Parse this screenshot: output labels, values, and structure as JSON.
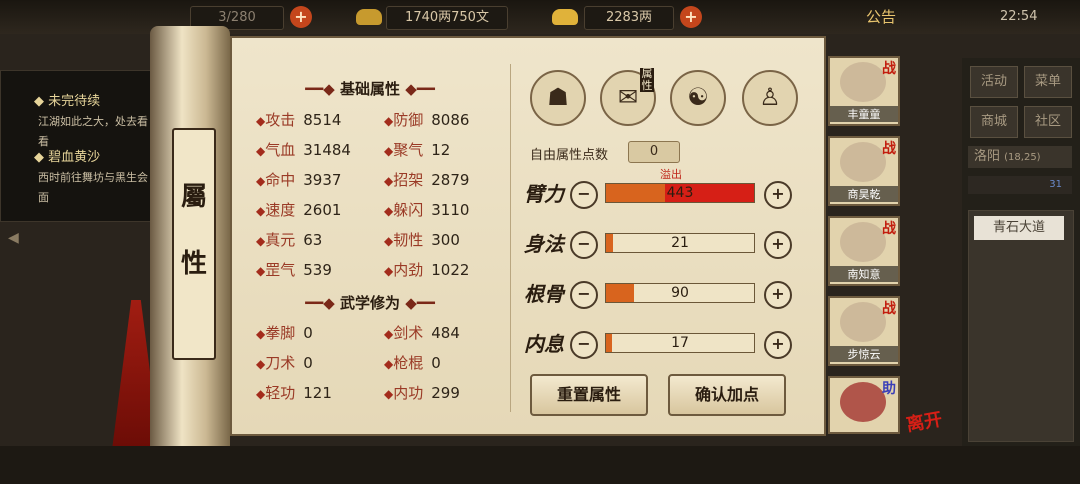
{
  "topbar": {
    "capacity": "3/280",
    "silver": "1740两750文",
    "gold": "2283两",
    "notice": "公告",
    "time": "22:54"
  },
  "quests": [
    {
      "title": "未完待续",
      "desc": "江湖如此之大，处去看看"
    },
    {
      "title": "碧血黄沙",
      "desc": "西时前往舞坊与黑生会面"
    }
  ],
  "scroll_label": [
    "屬",
    "性"
  ],
  "basic": {
    "title": "基础属性",
    "left": [
      {
        "label": "攻击",
        "value": "8514"
      },
      {
        "label": "气血",
        "value": "31484"
      },
      {
        "label": "命中",
        "value": "3937"
      },
      {
        "label": "速度",
        "value": "2601"
      },
      {
        "label": "真元",
        "value": "63"
      },
      {
        "label": "罡气",
        "value": "539"
      }
    ],
    "right": [
      {
        "label": "防御",
        "value": "8086"
      },
      {
        "label": "聚气",
        "value": "12"
      },
      {
        "label": "招架",
        "value": "2879"
      },
      {
        "label": "躲闪",
        "value": "3110"
      },
      {
        "label": "韧性",
        "value": "300"
      },
      {
        "label": "内劲",
        "value": "1022"
      }
    ]
  },
  "martial": {
    "title": "武学修为",
    "left": [
      {
        "label": "拳脚",
        "value": "0"
      },
      {
        "label": "刀术",
        "value": "0"
      },
      {
        "label": "轻功",
        "value": "121"
      }
    ],
    "right": [
      {
        "label": "剑术",
        "value": "484"
      },
      {
        "label": "枪棍",
        "value": "0"
      },
      {
        "label": "内功",
        "value": "299"
      }
    ]
  },
  "tabs": {
    "attr_badge": "属性"
  },
  "free_points": {
    "label": "自由属性点数",
    "value": "0"
  },
  "attributes": [
    {
      "name": "臂力",
      "value": "443",
      "fill": 1.0,
      "overflow_label": "溢出"
    },
    {
      "name": "身法",
      "value": "21",
      "fill": 0.05
    },
    {
      "name": "根骨",
      "value": "90",
      "fill": 0.19
    },
    {
      "name": "内息",
      "value": "17",
      "fill": 0.04
    }
  ],
  "buttons": {
    "reset": "重置属性",
    "confirm": "确认加点"
  },
  "party": [
    {
      "name": "丰童童",
      "badge": "战"
    },
    {
      "name": "商昊乾",
      "badge": "战"
    },
    {
      "name": "南知意",
      "badge": "战"
    },
    {
      "name": "步惊云",
      "badge": "战"
    },
    {
      "name": "",
      "badge": "助"
    }
  ],
  "leave_label": "离开",
  "side_menu": [
    "活动",
    "菜单",
    "商城",
    "社区"
  ],
  "location": {
    "city": "洛阳",
    "coords": "(18,25)",
    "road": "青石大道",
    "counter": "31"
  },
  "colors": {
    "bar_fill": "#d8641e",
    "bar_overflow": "#d61f16",
    "accent_red": "#a32c1c"
  }
}
